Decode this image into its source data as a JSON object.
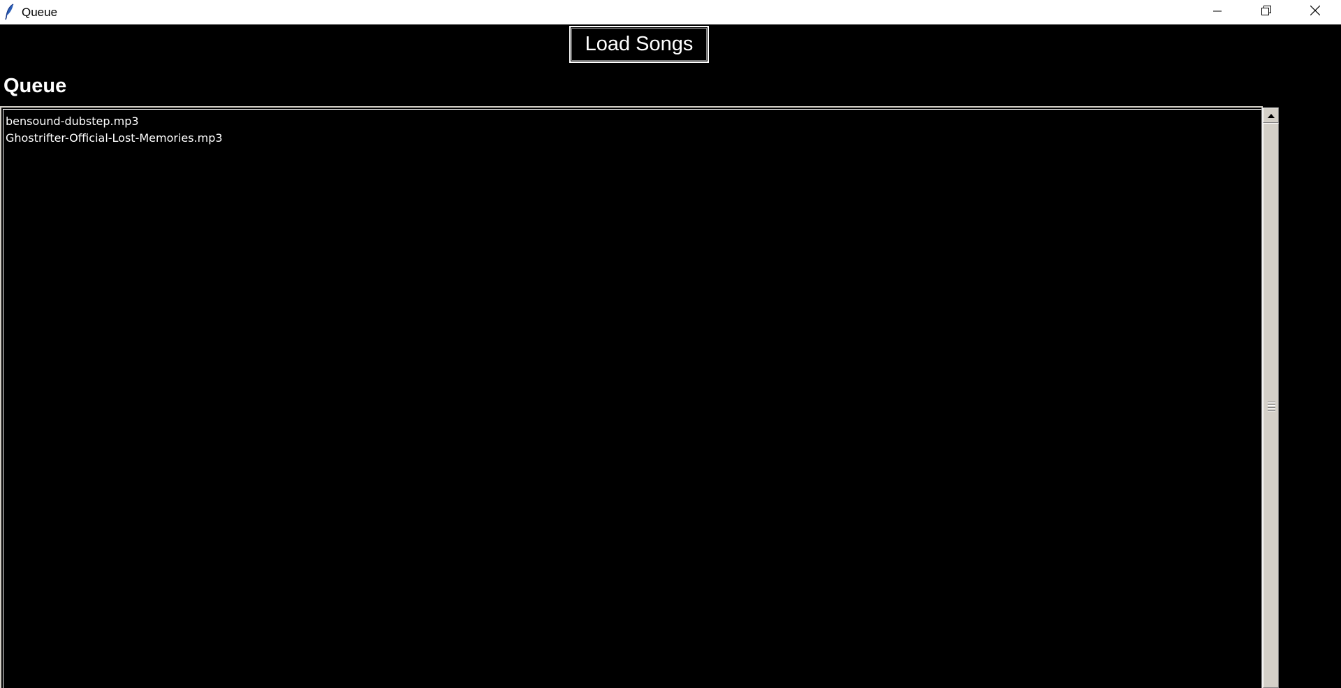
{
  "window": {
    "title": "Queue",
    "icon": "feather-icon"
  },
  "controls": {
    "minimize_icon": "minimize-icon",
    "restore_icon": "restore-icon",
    "close_icon": "close-icon"
  },
  "toolbar": {
    "load_label": "Load Songs"
  },
  "queue": {
    "heading": "Queue",
    "items": [
      "bensound-dubstep.mp3",
      "Ghostrifter-Official-Lost-Memories.mp3"
    ]
  },
  "colors": {
    "background": "#000000",
    "text": "#ffffff",
    "titlebar": "#ffffff"
  }
}
